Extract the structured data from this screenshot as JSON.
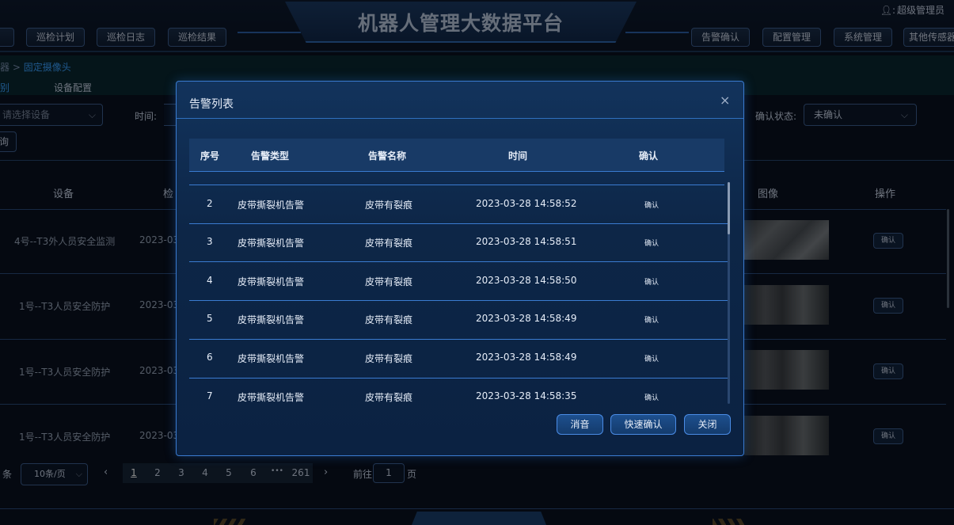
{
  "header": {
    "title": "机器人管理大数据平台",
    "user_label": "超级管理员",
    "nav_left": [
      "巡检计划",
      "巡检日志",
      "巡检结果"
    ],
    "nav_right": [
      "告警确认",
      "配置管理",
      "系统管理",
      "其他传感器"
    ]
  },
  "breadcrumb": {
    "prev": "器",
    "sep": ">",
    "current": "固定摄像头"
  },
  "subtabs": [
    "别",
    "设备配置"
  ],
  "filters": {
    "device_placeholder": "请选择设备",
    "time_label": "时间:",
    "confirm_state_label": "确认状态:",
    "confirm_state_value": "未确认",
    "side_button": "询"
  },
  "bg_table": {
    "headers": {
      "device": "设备",
      "time": "检",
      "image": "图像",
      "action": "操作"
    },
    "rows": [
      {
        "device": "4号--T3外人员安全监测",
        "time": "2023-03",
        "action": "确认"
      },
      {
        "device": "1号--T3人员安全防护",
        "time": "2023-03",
        "action": "确认"
      },
      {
        "device": "1号--T3人员安全防护",
        "time": "2023-03",
        "action": "确认"
      },
      {
        "device": "1号--T3人员安全防护",
        "time": "2023-03",
        "action": "确认"
      }
    ]
  },
  "pagination": {
    "total_suffix": "条",
    "page_size": "10条/页",
    "pages": [
      "1",
      "2",
      "3",
      "4",
      "5",
      "6",
      "•••",
      "261"
    ],
    "active_page": "1",
    "goto_label": "前往",
    "goto_value": "1",
    "page_suffix": "页"
  },
  "dialog": {
    "title": "告警列表",
    "close_icon": "×",
    "columns": [
      "序号",
      "告警类型",
      "告警名称",
      "时间",
      "确认"
    ],
    "rows": [
      {
        "index": "2",
        "type": "皮带撕裂机告警",
        "name": "皮带有裂痕",
        "time": "2023-03-28 14:58:52",
        "action": "确认"
      },
      {
        "index": "3",
        "type": "皮带撕裂机告警",
        "name": "皮带有裂痕",
        "time": "2023-03-28 14:58:51",
        "action": "确认"
      },
      {
        "index": "4",
        "type": "皮带撕裂机告警",
        "name": "皮带有裂痕",
        "time": "2023-03-28 14:58:50",
        "action": "确认"
      },
      {
        "index": "5",
        "type": "皮带撕裂机告警",
        "name": "皮带有裂痕",
        "time": "2023-03-28 14:58:49",
        "action": "确认"
      },
      {
        "index": "6",
        "type": "皮带撕裂机告警",
        "name": "皮带有裂痕",
        "time": "2023-03-28 14:58:49",
        "action": "确认"
      },
      {
        "index": "7",
        "type": "皮带撕裂机告警",
        "name": "皮带有裂痕",
        "time": "2023-03-28 14:58:35",
        "action": "确认"
      }
    ],
    "buttons": {
      "mute": "消音",
      "quick_confirm": "快速确认",
      "close": "关闭"
    }
  },
  "colors": {
    "accent": "#3a7bd0",
    "link": "#3aa0ff",
    "background": "#0a1220"
  }
}
